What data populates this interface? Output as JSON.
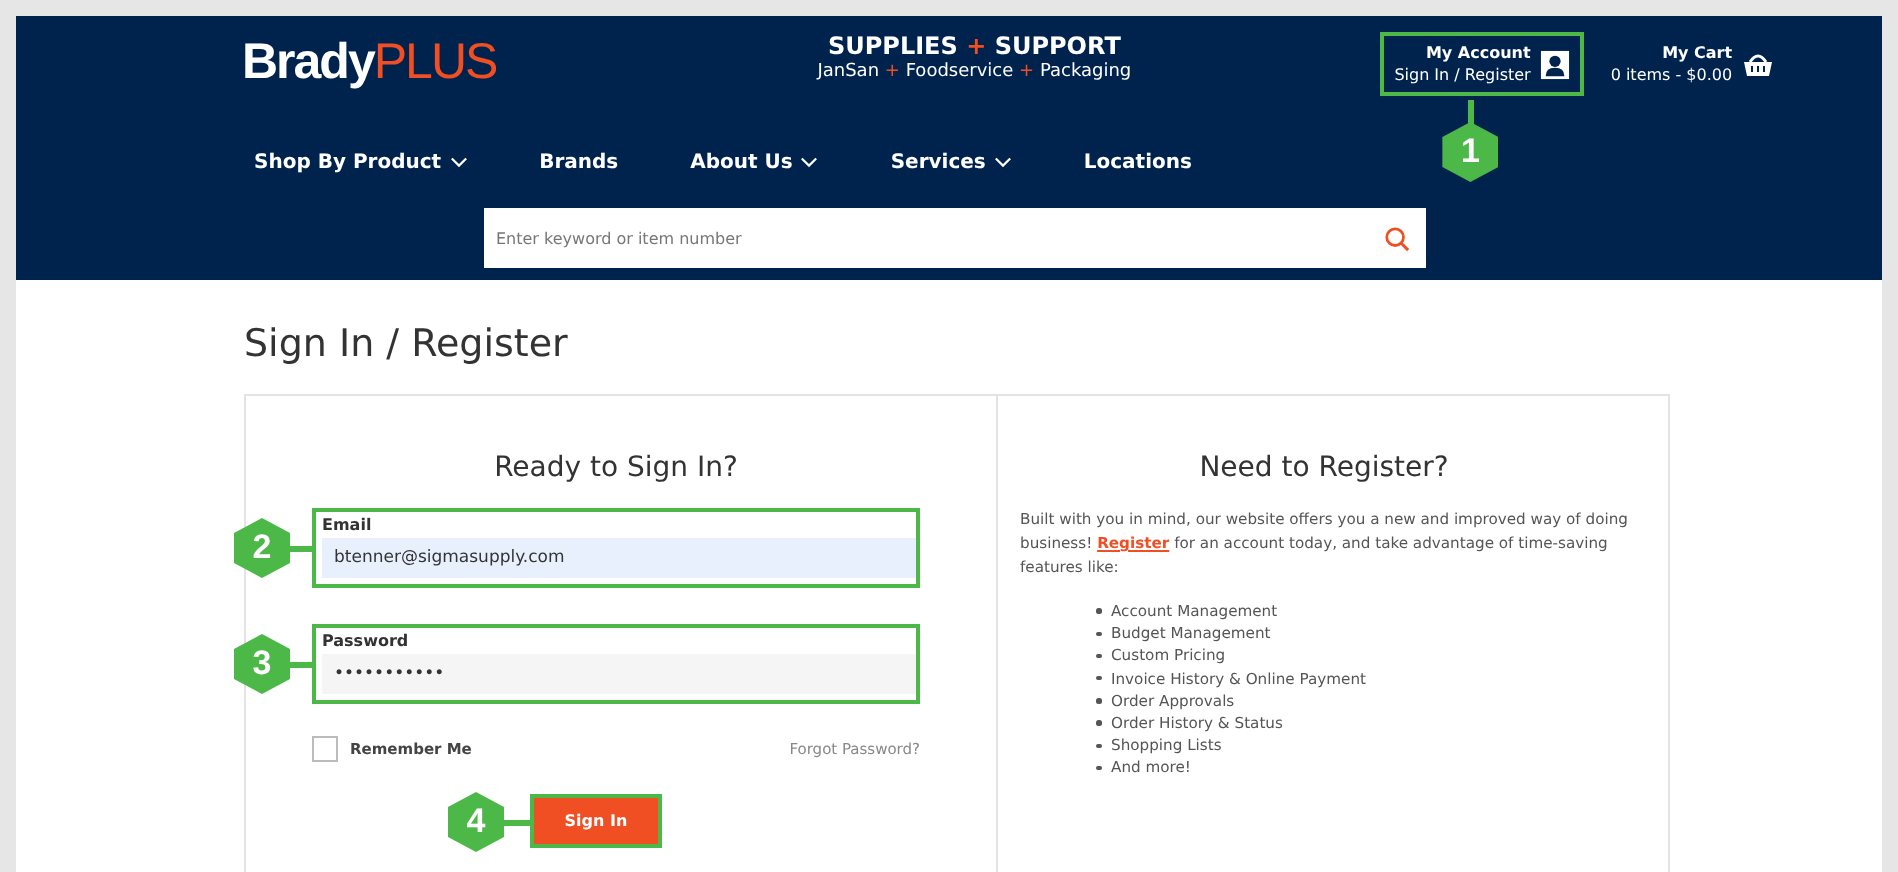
{
  "header": {
    "logo": {
      "main": "Brady",
      "accent": "PLUS"
    },
    "tagline": {
      "title_left": "SUPPLIES",
      "title_plus": "+",
      "title_right": "SUPPORT",
      "sub": [
        {
          "text": "JanSan"
        },
        {
          "text": "+",
          "kind": "plus"
        },
        {
          "text": "Foodservice"
        },
        {
          "text": "+",
          "kind": "plus"
        },
        {
          "text": "Packaging"
        }
      ]
    },
    "account": {
      "title": "My Account",
      "subtitle": "Sign In / Register",
      "callout": "1"
    },
    "cart": {
      "title": "My Cart",
      "subtitle": "0 items - $0.00"
    },
    "nav": [
      {
        "label": "Shop By Product",
        "dropdown": true
      },
      {
        "label": "Brands",
        "dropdown": false
      },
      {
        "label": "About Us",
        "dropdown": true
      },
      {
        "label": "Services",
        "dropdown": true
      },
      {
        "label": "Locations",
        "dropdown": false
      }
    ],
    "search": {
      "placeholder": "Enter keyword or item number"
    }
  },
  "page_title": "Sign In / Register",
  "sign_in": {
    "heading": "Ready to Sign In?",
    "email": {
      "label": "Email",
      "value": "btenner@sigmasupply.com",
      "callout": "2",
      "autofilled": true
    },
    "password": {
      "label": "Password",
      "value": "•••••••••••",
      "callout": "3",
      "autofilled": false
    },
    "remember": {
      "label": "Remember Me",
      "checked": false
    },
    "forgot": "Forgot Password?",
    "button": {
      "label": "Sign In",
      "callout": "4"
    }
  },
  "register": {
    "heading": "Need to Register?",
    "intro": {
      "before": "Built with you in mind, our website offers you a new and improved way of doing business! ",
      "link": "Register",
      "after": " for an account today, and take advantage of time-saving features like:"
    },
    "features": [
      "Account Management",
      "Budget Management",
      "Custom Pricing",
      "Invoice History & Online Payment",
      "Order Approvals",
      "Order History & Status",
      "Shopping Lists",
      "And more!"
    ]
  }
}
